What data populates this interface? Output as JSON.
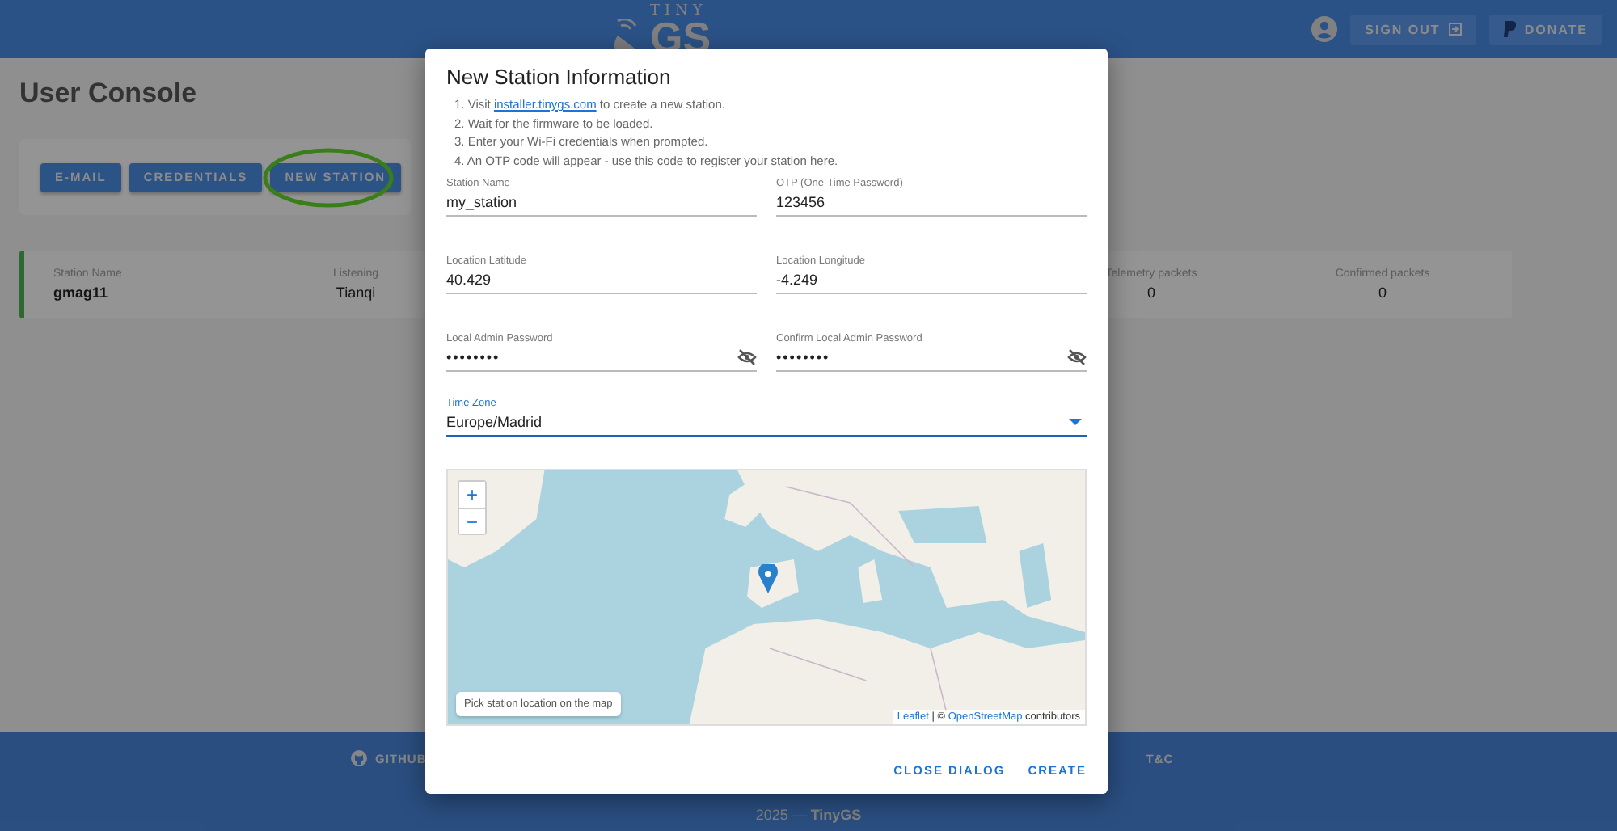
{
  "header": {
    "logo_top": "TINY",
    "logo_bottom": "GS",
    "buttons": [
      "SIGN OUT",
      "DONATE"
    ]
  },
  "page": {
    "title": "User Console",
    "actions": [
      {
        "label": "E-MAIL",
        "highlighted": false
      },
      {
        "label": "CREDENTIALS",
        "highlighted": false
      },
      {
        "label": "NEW STATION",
        "highlighted": true
      }
    ]
  },
  "station": {
    "columns": [
      {
        "label": "Station Name",
        "value": "gmag11"
      },
      {
        "label": "Listening",
        "value": "Tianqi"
      },
      {
        "label": "Telemetry packets",
        "value": "0"
      },
      {
        "label": "Confirmed packets",
        "value": "0"
      }
    ]
  },
  "footer": {
    "links": [
      "GITHUB",
      "T&C"
    ],
    "copyright": "2025 — **TinyGS**"
  },
  "dialog": {
    "title": "New Station Information",
    "steps": [
      {
        "before": "1. Visit ",
        "link": "installer.tinygs.com",
        "after": " to create a new station."
      },
      {
        "before": "2. Wait for the firmware to be loaded."
      },
      {
        "before": "3. Enter your Wi-Fi credentials when prompted."
      },
      {
        "before": "4. An OTP code will appear - use this code to register your station here."
      }
    ],
    "fields": [
      {
        "kind": "text",
        "label": "Station Name",
        "value": "my_station"
      },
      {
        "kind": "text",
        "label": "OTP (One-Time Password)",
        "value": "123456"
      },
      {
        "kind": "text",
        "label": "Location Latitude",
        "value": "40.429"
      },
      {
        "kind": "text",
        "label": "Location Longitude",
        "value": "-4.249"
      },
      {
        "kind": "password",
        "label": "Local Admin Password",
        "value": "••••••••"
      },
      {
        "kind": "password",
        "label": "Confirm Local Admin Password",
        "value": "••••••••"
      }
    ],
    "timezone": {
      "label": "Time Zone",
      "value": "Europe/Madrid"
    },
    "map": {
      "zoom_in": "+",
      "zoom_out": "−",
      "hint": "Pick station location on the map",
      "attribution": {
        "link1": "Leaflet",
        "sep": " | © ",
        "link2": "OpenStreetMap",
        "after": " contributors"
      }
    },
    "buttons": [
      "CLOSE DIALOG",
      "CREATE"
    ]
  }
}
